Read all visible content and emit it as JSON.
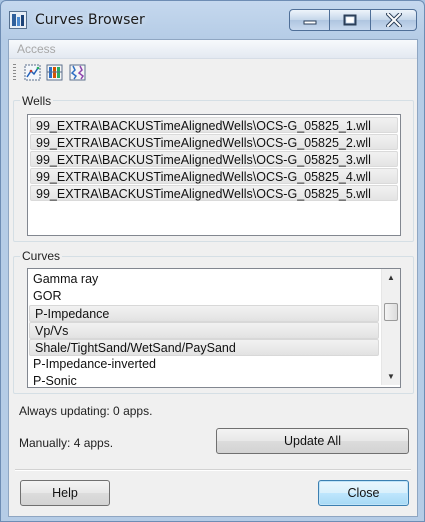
{
  "window": {
    "title": "Curves Browser"
  },
  "menu": {
    "items": [
      {
        "label": "Access",
        "enabled": false
      }
    ]
  },
  "toolbar": {
    "tools": [
      {
        "icon": "select-all-icon"
      },
      {
        "icon": "column-grid-icon"
      },
      {
        "icon": "curve-chart-icon"
      }
    ]
  },
  "wells": {
    "label": "Wells",
    "items": [
      "99_EXTRA\\BACKUSTimeAlignedWells\\OCS-G_05825_1.wll",
      "99_EXTRA\\BACKUSTimeAlignedWells\\OCS-G_05825_2.wll",
      "99_EXTRA\\BACKUSTimeAlignedWells\\OCS-G_05825_3.wll",
      "99_EXTRA\\BACKUSTimeAlignedWells\\OCS-G_05825_4.wll",
      "99_EXTRA\\BACKUSTimeAlignedWells\\OCS-G_05825_5.wll"
    ]
  },
  "curves": {
    "label": "Curves",
    "items": [
      {
        "name": "Gamma ray",
        "selected": false
      },
      {
        "name": "GOR",
        "selected": false
      },
      {
        "name": "P-Impedance",
        "selected": true
      },
      {
        "name": "Vp/Vs",
        "selected": true
      },
      {
        "name": "Shale/TightSand/WetSand/PaySand",
        "selected": true
      },
      {
        "name": "P-Impedance-inverted",
        "selected": false
      },
      {
        "name": "P-Sonic",
        "selected": false
      }
    ]
  },
  "status": {
    "always": "Always updating: 0 apps.",
    "manual": "Manually: 4 apps."
  },
  "buttons": {
    "update_all": "Update All",
    "help": "Help",
    "close": "Close"
  },
  "colors": {
    "title_frame": "#b5cce6",
    "default_button_border": "#3c7fb1"
  }
}
